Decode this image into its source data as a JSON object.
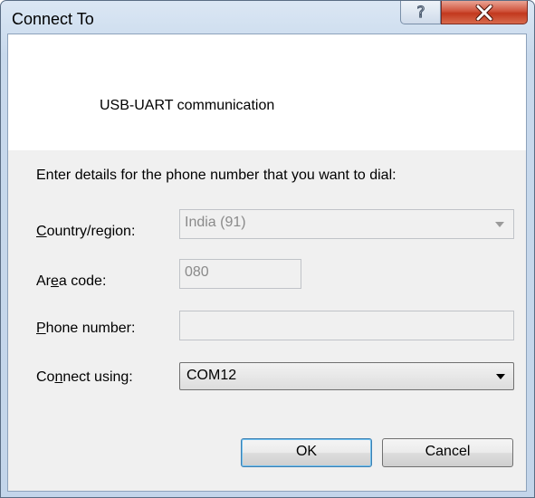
{
  "window": {
    "title": "Connect To"
  },
  "header": {
    "connection_name": "USB-UART communication"
  },
  "prompt": "Enter details for the phone number that you want to dial:",
  "fields": {
    "country": {
      "label_pre": "",
      "label_u": "C",
      "label_post": "ountry/region:",
      "value": "India (91)",
      "enabled": false
    },
    "area": {
      "label_pre": "Ar",
      "label_u": "e",
      "label_post": "a code:",
      "value": "080",
      "enabled": false
    },
    "phone": {
      "label_pre": "",
      "label_u": "P",
      "label_post": "hone number:",
      "value": "",
      "enabled": false
    },
    "connect": {
      "label_pre": "Co",
      "label_u": "n",
      "label_post": "nect using:",
      "value": "COM12",
      "enabled": true
    }
  },
  "buttons": {
    "ok": "OK",
    "cancel": "Cancel"
  },
  "icons": {
    "help": "help-icon",
    "close": "close-icon",
    "dropdown": "chevron-down-icon"
  }
}
